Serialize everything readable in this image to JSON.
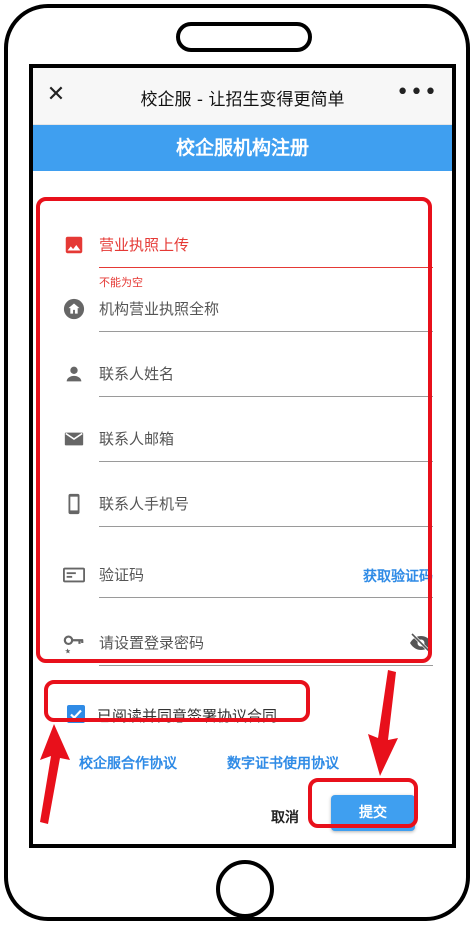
{
  "titlebar": {
    "title": "校企服 - 让招生变得更简单",
    "close_icon": "close-icon",
    "more_icon": "more-icon"
  },
  "header": {
    "title": "校企服机构注册"
  },
  "form": {
    "license_upload": {
      "label": "营业执照上传",
      "error": "不能为空",
      "icon": "image-icon"
    },
    "org_name": {
      "label": "机构营业执照全称",
      "icon": "home-icon"
    },
    "contact_name": {
      "label": "联系人姓名",
      "icon": "person-icon"
    },
    "contact_email": {
      "label": "联系人邮箱",
      "icon": "mail-icon"
    },
    "contact_phone": {
      "label": "联系人手机号",
      "icon": "phone-icon"
    },
    "code": {
      "label": "验证码",
      "action": "获取验证码",
      "icon": "sms-icon"
    },
    "password": {
      "label": "请设置登录密码",
      "icon": "key-icon",
      "toggle_icon": "eye-off-icon"
    }
  },
  "agreement": {
    "checked": true,
    "label": "已阅读并同意签署协议合同",
    "link1": "校企服合作协议",
    "link2": "数字证书使用协议"
  },
  "actions": {
    "cancel": "取消",
    "submit": "提交"
  },
  "colors": {
    "accent": "#3f9ff0",
    "link": "#2f8be6",
    "error": "#e53935",
    "highlight": "#e8101b"
  }
}
